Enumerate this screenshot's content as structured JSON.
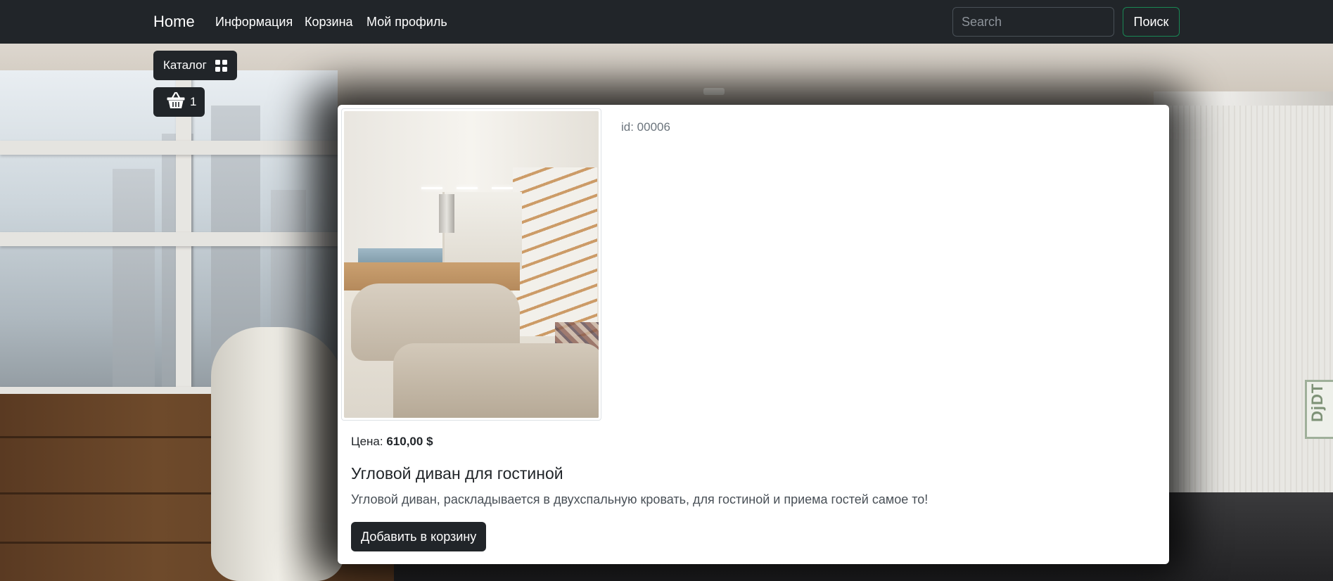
{
  "navbar": {
    "brand": "Home",
    "links": [
      "Информация",
      "Корзина",
      "Мой профиль"
    ],
    "search": {
      "placeholder": "Search",
      "value": ""
    },
    "search_button": "Поиск"
  },
  "catalog_button": {
    "label": "Каталог",
    "icon": "grid-icon"
  },
  "cart_button": {
    "icon": "basket-icon",
    "count": "1"
  },
  "product": {
    "id_label": "id: 00006",
    "price_label": "Цена:",
    "price_value": "610,00 $",
    "title": "Угловой диван для гостиной",
    "description": "Угловой диван, раскладывается в двухспальную кровать, для гостиной и приема гостей самое то!",
    "add_to_cart": "Добавить в корзину"
  },
  "background": {
    "sign_text": "DjDT"
  },
  "colors": {
    "navbar": "#212529",
    "search_button_border": "#198754",
    "card": "#ffffff"
  }
}
